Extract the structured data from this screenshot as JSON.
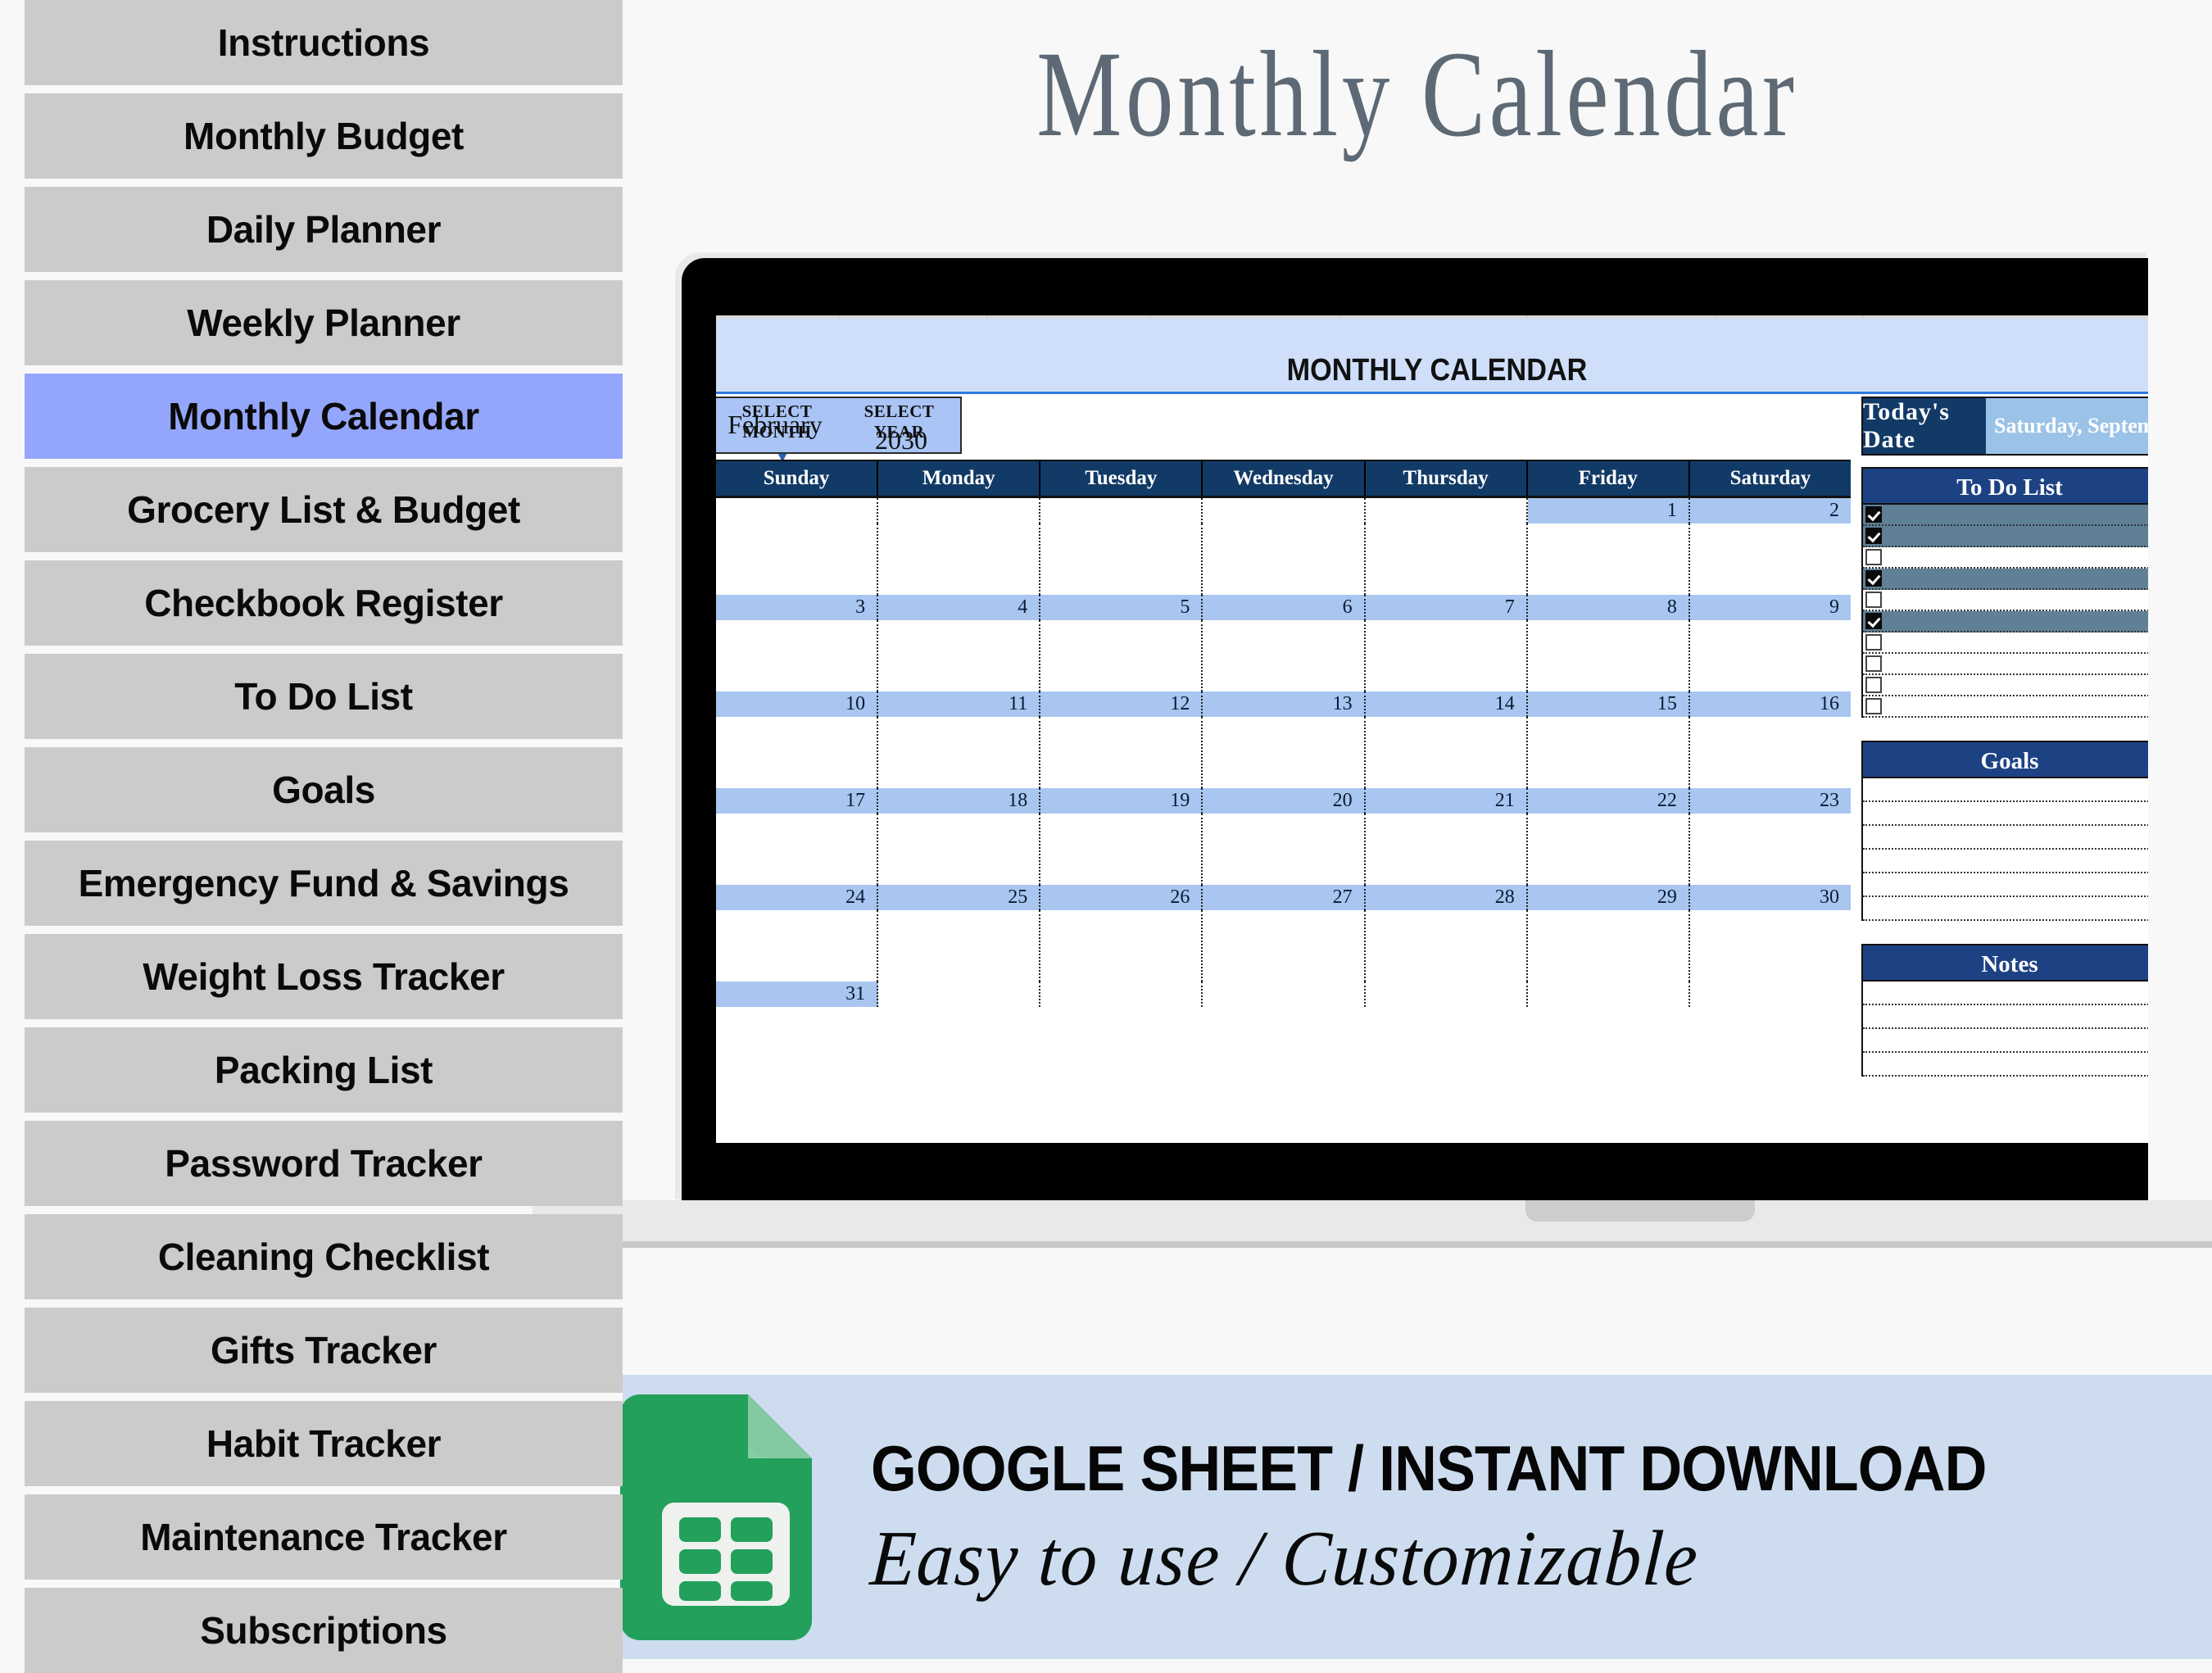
{
  "page": {
    "title": "Monthly Calendar",
    "title_color": "#5d6a75",
    "background": "#f8f8f8"
  },
  "sidebar": {
    "active_index": 4,
    "item_bg": "#cbcbcb",
    "active_bg": "#94a6fc",
    "items": [
      {
        "label": "Instructions"
      },
      {
        "label": "Monthly Budget"
      },
      {
        "label": "Daily Planner"
      },
      {
        "label": "Weekly Planner"
      },
      {
        "label": "Monthly Calendar"
      },
      {
        "label": "Grocery List & Budget"
      },
      {
        "label": "Checkbook Register"
      },
      {
        "label": "To Do List"
      },
      {
        "label": "Goals"
      },
      {
        "label": "Emergency Fund & Savings"
      },
      {
        "label": "Weight Loss Tracker"
      },
      {
        "label": "Packing List"
      },
      {
        "label": "Password Tracker"
      },
      {
        "label": "Cleaning Checklist"
      },
      {
        "label": "Gifts Tracker"
      },
      {
        "label": "Habit Tracker"
      },
      {
        "label": "Maintenance Tracker"
      },
      {
        "label": "Subscriptions"
      }
    ]
  },
  "spreadsheet": {
    "banner_title": "MONTHLY CALENDAR",
    "banner_bg": "#cfdffa",
    "header_bg": "#123a66",
    "accent_blue": "#1d4284",
    "date_bar_bg": "#a8c6f0",
    "selector": {
      "month_label": "SELECT MONTH",
      "year_label": "SELECT YEAR",
      "month_value": "February",
      "year_value": "2030",
      "dropdown_icon": "chevron-down-icon"
    },
    "today": {
      "label": "Today's  Date",
      "value": "Saturday, September"
    },
    "calendar": {
      "day_headers": [
        "Sunday",
        "Monday",
        "Tuesday",
        "Wednesday",
        "Thursday",
        "Friday",
        "Saturday"
      ],
      "weeks": [
        [
          "",
          "",
          "",
          "",
          "",
          "1",
          "2"
        ],
        [
          "3",
          "4",
          "5",
          "6",
          "7",
          "8",
          "9"
        ],
        [
          "10",
          "11",
          "12",
          "13",
          "14",
          "15",
          "16"
        ],
        [
          "17",
          "18",
          "19",
          "20",
          "21",
          "22",
          "23"
        ],
        [
          "24",
          "25",
          "26",
          "27",
          "28",
          "29",
          "30"
        ],
        [
          "31",
          "",
          "",
          "",
          "",
          "",
          ""
        ]
      ]
    },
    "todo": {
      "heading": "To Do List",
      "rows": [
        {
          "checked": true,
          "text": ""
        },
        {
          "checked": true,
          "text": ""
        },
        {
          "checked": false,
          "text": ""
        },
        {
          "checked": true,
          "text": ""
        },
        {
          "checked": false,
          "text": ""
        },
        {
          "checked": true,
          "text": ""
        },
        {
          "checked": false,
          "text": ""
        },
        {
          "checked": false,
          "text": ""
        },
        {
          "checked": false,
          "text": ""
        },
        {
          "checked": false,
          "text": ""
        }
      ]
    },
    "goals": {
      "heading": "Goals",
      "line_count": 6
    },
    "notes": {
      "heading": "Notes",
      "line_count": 4
    }
  },
  "banner": {
    "bg": "#cdddef",
    "line1": "GOOGLE SHEET / INSTANT DOWNLOAD",
    "line2": "Easy to use / Customizable",
    "logo_name": "google-sheets-icon",
    "logo_green": "#23a05b"
  }
}
